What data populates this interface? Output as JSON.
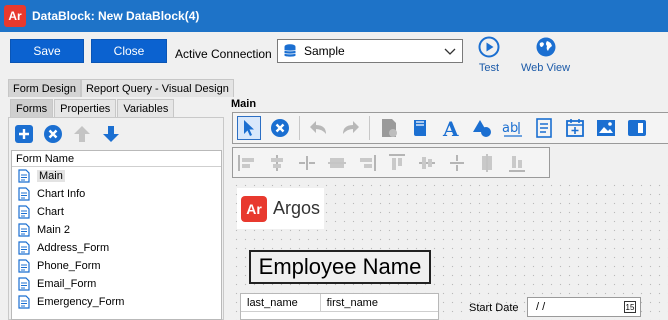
{
  "window": {
    "title": "DataBlock: New DataBlock(4)",
    "logo_text": "Ar"
  },
  "toolbar": {
    "save_label": "Save",
    "close_label": "Close",
    "connection_label": "Active Connection",
    "connection_value": "Sample",
    "test_label": "Test",
    "webview_label": "Web View"
  },
  "design_tabs": [
    "Form Design",
    "Report Query - Visual Design"
  ],
  "panel_tabs": [
    "Forms",
    "Properties",
    "Variables"
  ],
  "forms": {
    "header": "Form Name",
    "items": [
      "Main",
      "Chart Info",
      "Chart",
      "Main 2",
      "Address_Form",
      "Phone_Form",
      "Email_Form",
      "Emergency_Form"
    ]
  },
  "designer": {
    "form_title": "Main",
    "logo_text": "Argos",
    "logo_mark": "Ar",
    "heading": "Employee Name",
    "grid_columns": [
      "last_name",
      "first_name"
    ],
    "start_date_label": "Start Date",
    "start_date_value": " / /",
    "calendar_glyph": "15"
  },
  "colors": {
    "titlebar": "#1e73c8",
    "button": "#0b62d0",
    "brand": "#e8392e",
    "icon_blue": "#1b6fd1"
  }
}
